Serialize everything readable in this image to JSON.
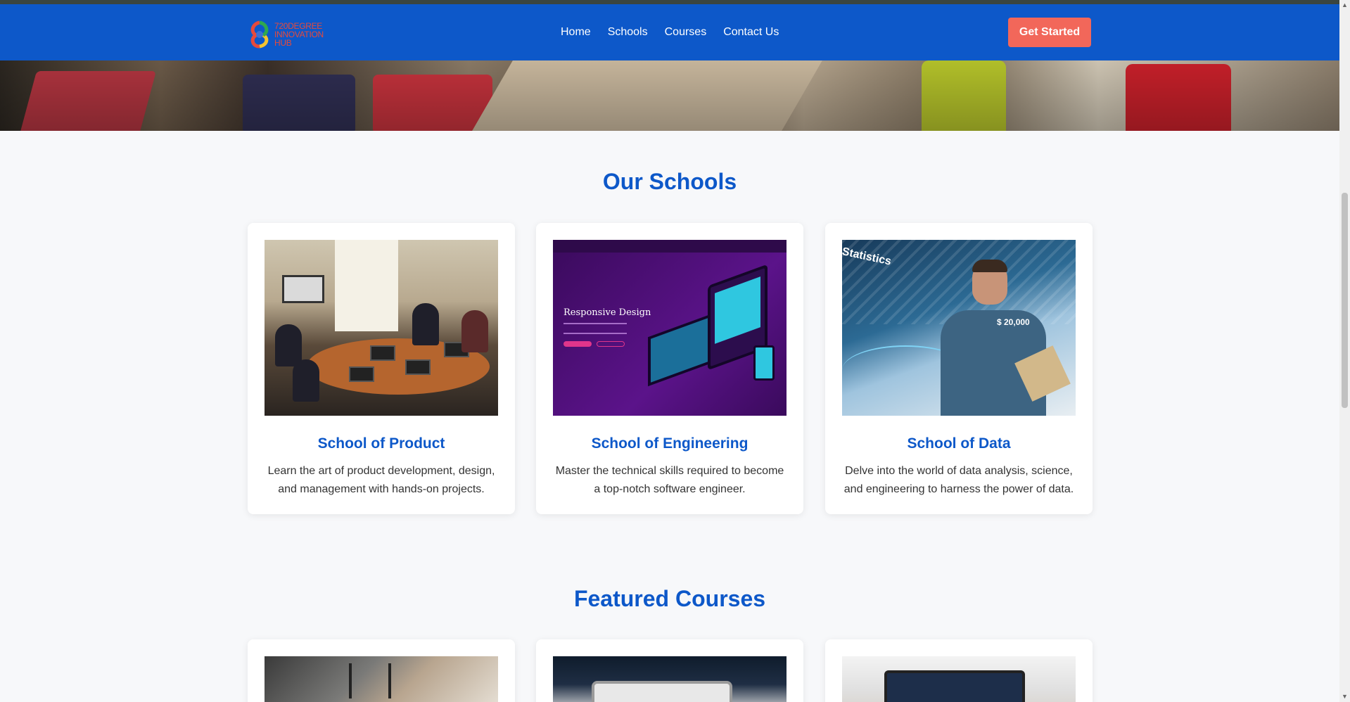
{
  "nav": {
    "logo_lines": [
      "720DEGREE",
      "INNOVATION",
      "HUB"
    ],
    "links": [
      "Home",
      "Schools",
      "Courses",
      "Contact Us"
    ],
    "cta": "Get Started"
  },
  "schools": {
    "title": "Our Schools",
    "cards": [
      {
        "title": "School of Product",
        "description": "Learn the art of product development, design, and management with hands-on projects."
      },
      {
        "title": "School of Engineering",
        "description": "Master the technical skills required to become a top-notch software engineer.",
        "image_text": "Responsive Design"
      },
      {
        "title": "School of Data",
        "description": "Delve into the world of data analysis, science, and engineering to harness the power of data.",
        "image_text": "Statistics",
        "image_money": "$ 20,000"
      }
    ]
  },
  "featured": {
    "title": "Featured Courses"
  },
  "colors": {
    "brand_blue": "#0d58c9",
    "cta_coral": "#f2675a",
    "background": "#f7f8fa"
  }
}
